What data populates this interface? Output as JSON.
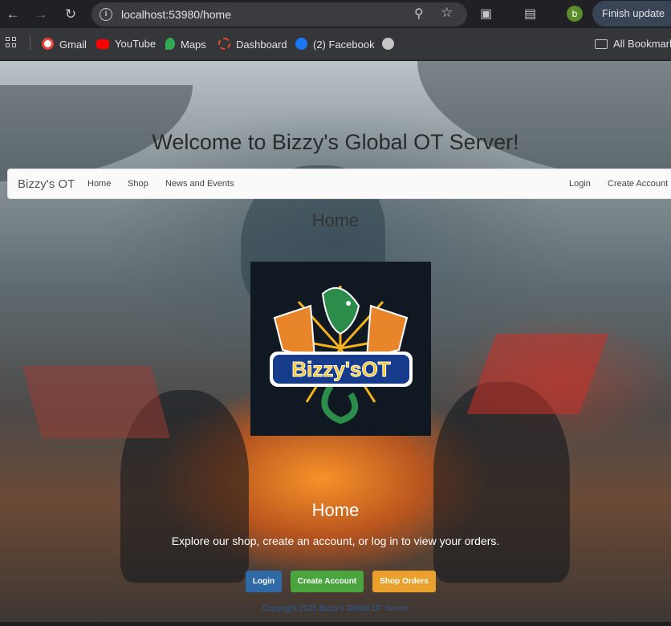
{
  "browser": {
    "url": "localhost:53980/home",
    "profile_initial": "b",
    "finish_update_label": "Finish update",
    "bookmarks": [
      {
        "label": "Gmail",
        "icon": "gmail-icon",
        "color": "#ea4335"
      },
      {
        "label": "YouTube",
        "icon": "youtube-icon",
        "color": "#ff0000"
      },
      {
        "label": "Maps",
        "icon": "maps-icon",
        "color": "#34a853"
      },
      {
        "label": "Dashboard",
        "icon": "dashboard-icon",
        "color": "#e8452c"
      },
      {
        "label": "(2) Facebook",
        "icon": "facebook-icon",
        "color": "#1877f2"
      },
      {
        "label": "",
        "icon": "globe-icon",
        "color": "#c4c7c5"
      }
    ],
    "all_bookmarks_label": "All Bookmarks"
  },
  "page": {
    "welcome_title": "Welcome to Bizzy's Global OT Server!",
    "navbar": {
      "brand": "Bizzy's OT",
      "left_links": [
        "Home",
        "Shop",
        "News and Events"
      ],
      "right_links": [
        "Login",
        "Create Account"
      ]
    },
    "section_title": "Home",
    "logo": {
      "text": "Bizzy'sOT"
    },
    "hero": {
      "title": "Home",
      "subtitle": "Explore our shop, create an account, or log in to view your orders."
    },
    "buttons": [
      {
        "label": "Login",
        "color": "#2f6aa6"
      },
      {
        "label": "Create Account",
        "color": "#4aa53f"
      },
      {
        "label": "Shop Orders",
        "color": "#e9a02c"
      }
    ],
    "copyright": "Copyright 2025 Bizzy's Global OT Server"
  }
}
